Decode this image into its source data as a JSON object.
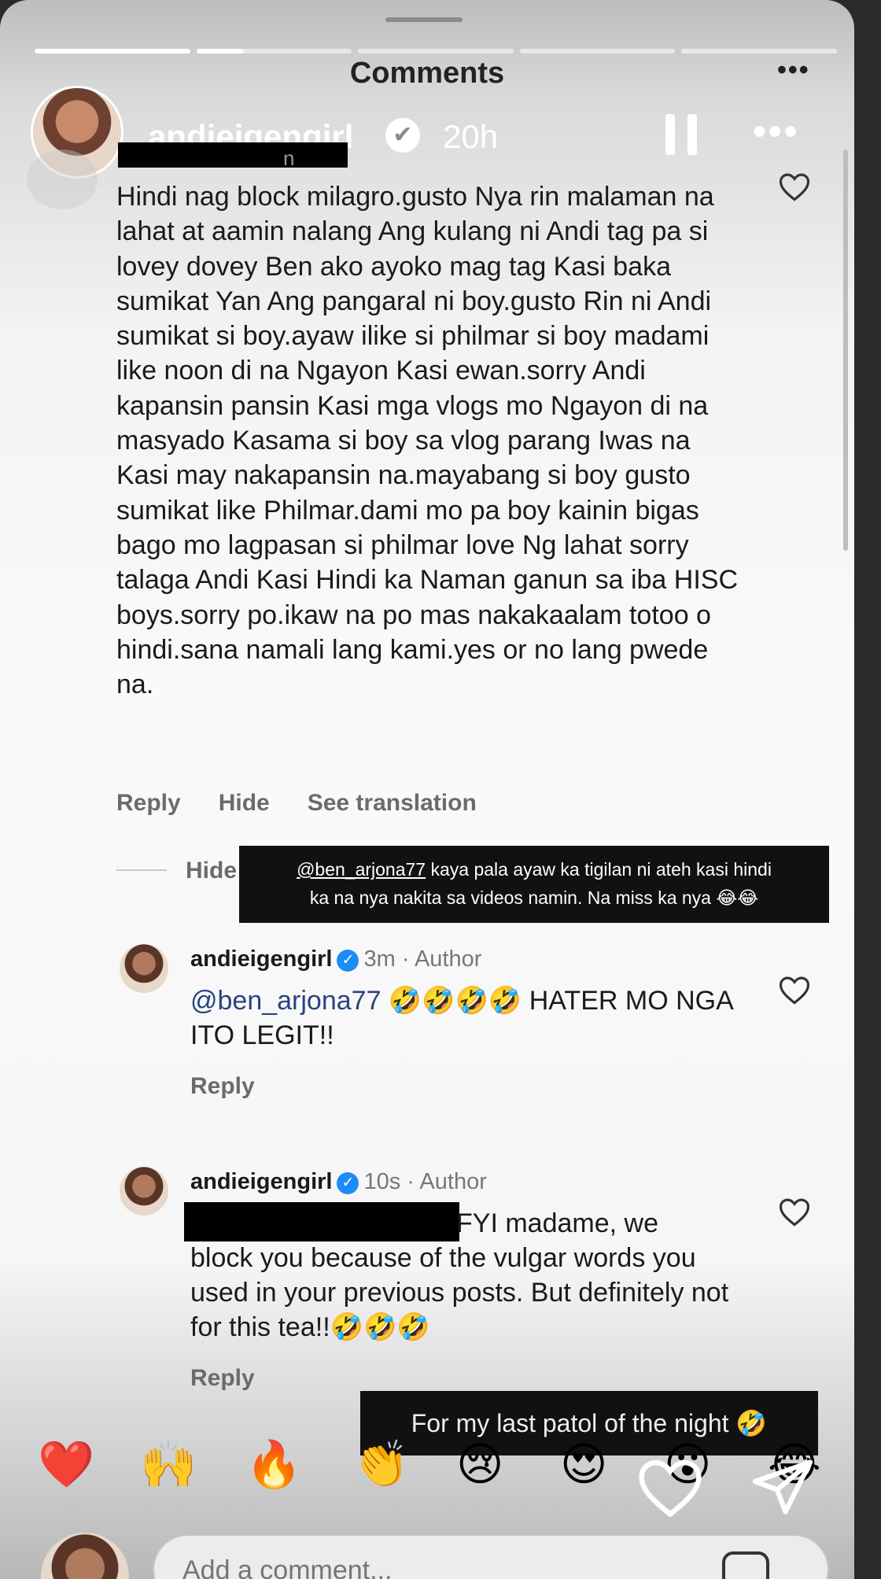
{
  "sheet": {
    "title": "Comments",
    "more": "•••"
  },
  "story": {
    "username": "andieigengirl",
    "verified_glyph": "✔",
    "time": "20h",
    "more": "•••",
    "progress": [
      1.0,
      0.3,
      0.0,
      0.0,
      0.0
    ]
  },
  "main_comment": {
    "username_fragment": "n",
    "text": "Hindi nag block milagro.gusto Nya rin malaman na lahat at aamin nalang Ang kulang ni Andi tag pa si lovey dovey Ben ako ayoko mag tag Kasi baka sumikat Yan Ang pangaral ni boy.gusto Rin ni Andi sumikat si boy.ayaw ilike si philmar si boy madami like noon di na Ngayon Kasi ewan.sorry Andi kapansin pansin Kasi mga vlogs mo Ngayon di na masyado Kasama si boy sa vlog parang Iwas na Kasi may nakapansin na.mayabang si boy gusto sumikat like Philmar.dami mo pa boy kainin bigas bago mo lagpasan si philmar love Ng lahat sorry talaga Andi Kasi Hindi ka Naman ganun sa iba HISC boys.sorry po.ikaw na po mas nakakaalam totoo o hindi.sana namali lang kami.yes or no lang pwede na.",
    "actions": {
      "reply": "Reply",
      "hide": "Hide",
      "translate": "See translation"
    }
  },
  "hide_replies": "Hide",
  "caption_overlay": {
    "mention": "@ben_arjona77",
    "line1_rest": " kaya pala ayaw ka tigilan ni ateh kasi hindi",
    "line2": "ka na nya nakita sa videos namin. Na miss ka nya 😂😂"
  },
  "replies": [
    {
      "username": "andieigengirl",
      "verified": "✓",
      "meta": "3m · Author",
      "mention": "@ben_arjona77",
      "text": " 🤣🤣🤣🤣 HATER MO NGA ITO LEGIT!!",
      "reply": "Reply"
    },
    {
      "username": "andieigengirl",
      "verified": "✓",
      "meta": "10s · Author",
      "text_line1": "FYI madame, we",
      "text_rest": "block you because of the vulgar words you used in your previous posts. But definitely not for this tea!!🤣🤣🤣",
      "reply": "Reply"
    }
  ],
  "caption_small": "For my last patol of the night 🤣",
  "reactions": [
    "❤️",
    "🙌",
    "🔥",
    "👏",
    "😢",
    "😍",
    "😮",
    "😂"
  ],
  "add_comment": {
    "placeholder": "Add a comment..."
  },
  "icons": {
    "heart": "heart-outline-icon",
    "share": "paper-plane-icon",
    "gif": "gif-sticker-icon",
    "pause": "pause-icon",
    "verified": "verified-badge-icon"
  },
  "colors": {
    "verified_blue": "#1d8cf8",
    "mention": "#27457e",
    "caption_bg": "#111111"
  }
}
